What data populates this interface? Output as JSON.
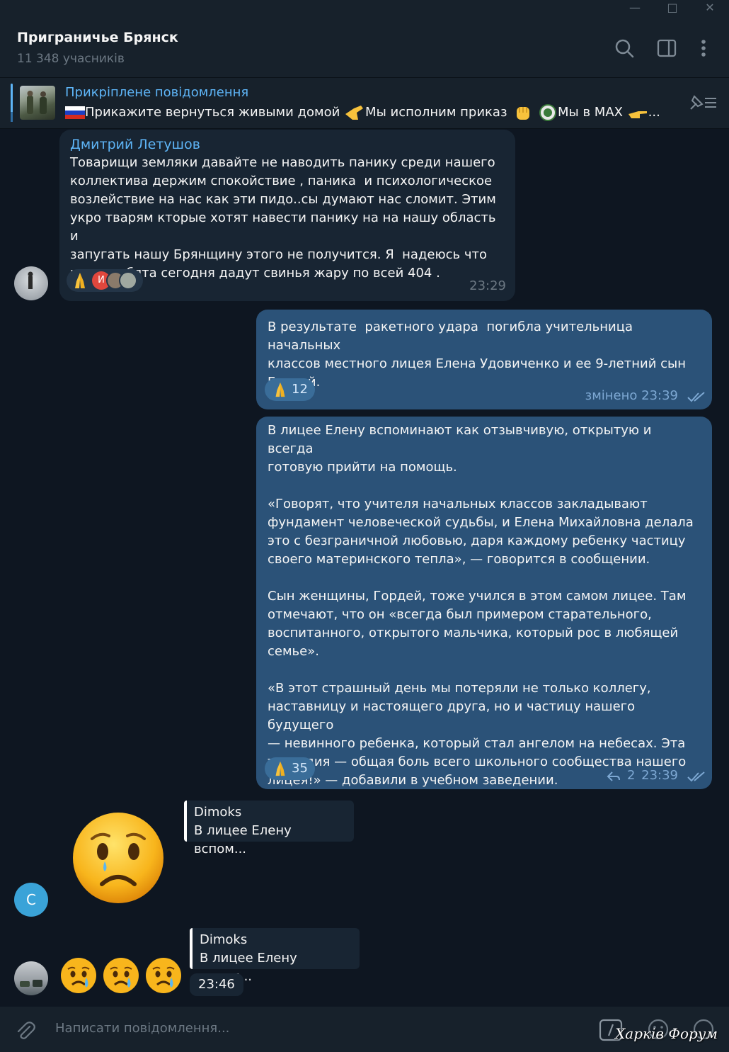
{
  "window": {
    "minimize_glyph": "—",
    "maximize_glyph": "□",
    "close_glyph": "✕"
  },
  "header": {
    "title": "Приграничье Брянск",
    "subtitle": "11 348 учасників"
  },
  "pinned": {
    "title": "Прикріплене повідомлення",
    "text_parts": [
      "Прикажите вернуться живыми домой",
      "Мы исполним приказ",
      "Мы в MAX",
      "..."
    ]
  },
  "messages": [
    {
      "sender": "Дмитрий Летушов",
      "text": "Товарищи земляки давайте не наводить панику среди нашего\nколлектива держим спокойствие , паника  и психологическое\nвозлействие на нас как эти пидо..сы думают нас сломит. Этим\nукро тварям кторые хотят навести панику на на нашу область и\nзапугать нашу Брянщину этого не получится. Я  надеюсь что\nнаши ребята сегодня дадут свинья жару по всей 404 .",
      "time": "23:29",
      "reaction_avatar_letter": "И"
    },
    {
      "text": "В результате  ракетного удара  погибла учительница начальных\nклассов местного лицея Елена Удовиченко и ее 9-летний сын\nГордей.",
      "reaction_count": "12",
      "time": "змінено 23:39"
    },
    {
      "text": "В лицее Елену вспоминают как отзывчивую, открытую и всегда\nготовую прийти на помощь.\n\n«Говорят, что учителя начальных классов закладывают\nфундамент человеческой судьбы, и Елена Михайловна делала\nэто с безграничной любовью, даря каждому ребенку частицу\nсвоего материнского тепла», — говорится в сообщении.\n\nСын женщины, Гордей, тоже учился в этом самом лицее. Там\nотмечают, что он «всегда был примером старательного,\nвоспитанного, открытого мальчика, который рос в любящей\nсемье».\n\n«В этот страшный день мы потеряли не только коллегу,\nнаставницу и настоящего друга, но и частицу нашего будущего\n— невинного ребенка, который стал ангелом на небесах. Эта\nтрагедия — общая боль всего школьного сообщества нашего\nлицея!» — добавили в учебном заведении.",
      "reaction_count": "35",
      "replies": "2",
      "time": "23:39"
    }
  ],
  "replies": [
    {
      "reply_name": "Dimoks",
      "reply_text": "В лицее Елену вспом...",
      "avatar_letter": "С",
      "emoji": "sad-tear-face"
    },
    {
      "reply_name": "Dimoks",
      "reply_text": "В лицее Елену вспом...",
      "time": "23:46",
      "emoji": "crying-face x3"
    }
  ],
  "composer": {
    "placeholder": "Написати повідомлення..."
  },
  "watermark": "Харків Форум",
  "colors": {
    "background": "#0e1621",
    "panel": "#17212b",
    "incoming": "#182533",
    "outgoing": "#2b5278",
    "accent": "#5eb5f7"
  }
}
